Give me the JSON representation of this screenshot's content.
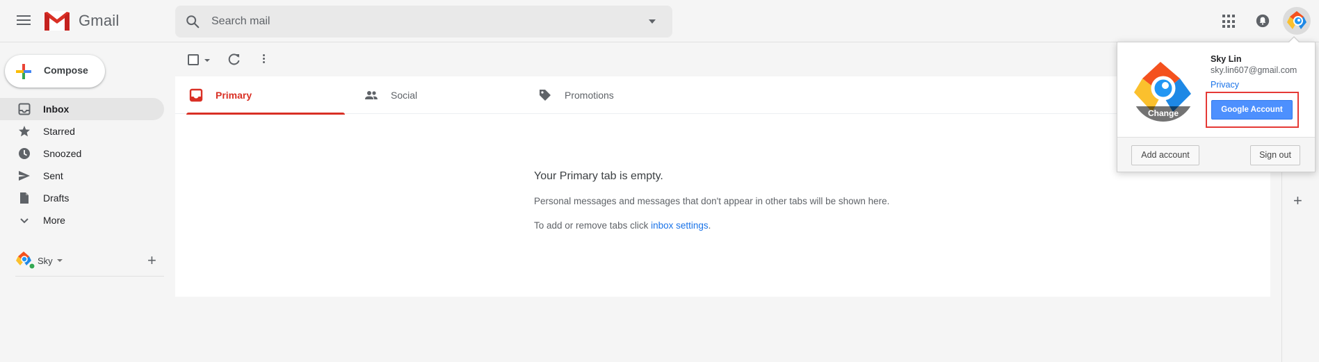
{
  "header": {
    "app_name": "Gmail",
    "search_placeholder": "Search mail"
  },
  "compose": {
    "label": "Compose"
  },
  "nav": {
    "items": [
      {
        "label": "Inbox",
        "icon": "inbox-icon",
        "active": true
      },
      {
        "label": "Starred",
        "icon": "star-icon"
      },
      {
        "label": "Snoozed",
        "icon": "clock-icon"
      },
      {
        "label": "Sent",
        "icon": "send-icon"
      },
      {
        "label": "Drafts",
        "icon": "draft-icon"
      },
      {
        "label": "More",
        "icon": "chevron-down-icon"
      }
    ]
  },
  "account_row": {
    "name": "Sky"
  },
  "tabs": [
    {
      "label": "Primary",
      "icon": "inbox-tab-icon",
      "active": true
    },
    {
      "label": "Social",
      "icon": "people-icon"
    },
    {
      "label": "Promotions",
      "icon": "tag-icon"
    }
  ],
  "empty_state": {
    "title": "Your Primary tab is empty.",
    "description": "Personal messages and messages that don't appear in other tabs will be shown here.",
    "settings_prefix": "To add or remove tabs click ",
    "settings_link": "inbox settings",
    "settings_suffix": "."
  },
  "account_popup": {
    "name": "Sky Lin",
    "email": "sky.lin607@gmail.com",
    "privacy_label": "Privacy",
    "avatar_change_label": "Change",
    "google_account_button": "Google Account",
    "add_account_button": "Add account",
    "sign_out_button": "Sign out"
  },
  "colors": {
    "accent_red": "#d93025",
    "button_blue": "#4d90fe",
    "link_blue": "#1a73e8",
    "highlight_red": "#e53935"
  }
}
